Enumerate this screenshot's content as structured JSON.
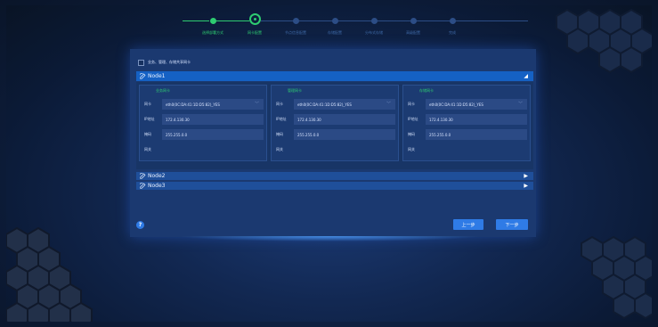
{
  "stepper": {
    "steps": [
      {
        "label": "选择部署方式",
        "state": "done"
      },
      {
        "label": "网卡配置",
        "state": "current"
      },
      {
        "label": "节点信息配置",
        "state": "todo"
      },
      {
        "label": "存储配置",
        "state": "todo"
      },
      {
        "label": "分布式存储",
        "state": "todo"
      },
      {
        "label": "高级配置",
        "state": "todo"
      },
      {
        "label": "完成",
        "state": "todo"
      }
    ]
  },
  "panel": {
    "share_checkbox_label": "业务、管理、存储共享网卡",
    "nodes": [
      {
        "title": "Node1",
        "expanded": true
      },
      {
        "title": "Node2",
        "expanded": false
      },
      {
        "title": "Node3",
        "expanded": false
      }
    ],
    "node1": {
      "columns": [
        {
          "title": "业务网卡",
          "nic_label": "网卡",
          "nic_value": "eth0(0C:DA:41:1D:D5:82)_YES",
          "ip_label": "IP地址",
          "ip_value": "172.4.130.30",
          "mask_label": "掩码",
          "mask_value": "255.255.0.0",
          "gateway_label": "网关",
          "gateway_value": ""
        },
        {
          "title": "管理网卡",
          "nic_label": "网卡",
          "nic_value": "eth0(0C:DA:41:1D:D5:82)_YES",
          "ip_label": "IP地址",
          "ip_value": "172.4.130.30",
          "mask_label": "掩码",
          "mask_value": "255.255.0.0",
          "gateway_label": "网关",
          "gateway_value": ""
        },
        {
          "title": "存储网卡",
          "nic_label": "网卡",
          "nic_value": "eth0(0C:DA:41:1D:D5:82)_YES",
          "ip_label": "IP地址",
          "ip_value": "172.4.130.30",
          "mask_label": "掩码",
          "mask_value": "255.255.0.0",
          "gateway_label": "网关",
          "gateway_value": ""
        }
      ]
    },
    "help_label": "?",
    "prev_label": "上一步",
    "next_label": "下一步"
  },
  "colors": {
    "accent": "#2f7be6",
    "done": "#2ecc71",
    "node_bar": "#1561c4"
  },
  "icons": {
    "edit": "edit-icon",
    "collapse": "triangle-up-icon",
    "expand": "triangle-right-icon",
    "dropdown": "chevron-down-icon"
  }
}
